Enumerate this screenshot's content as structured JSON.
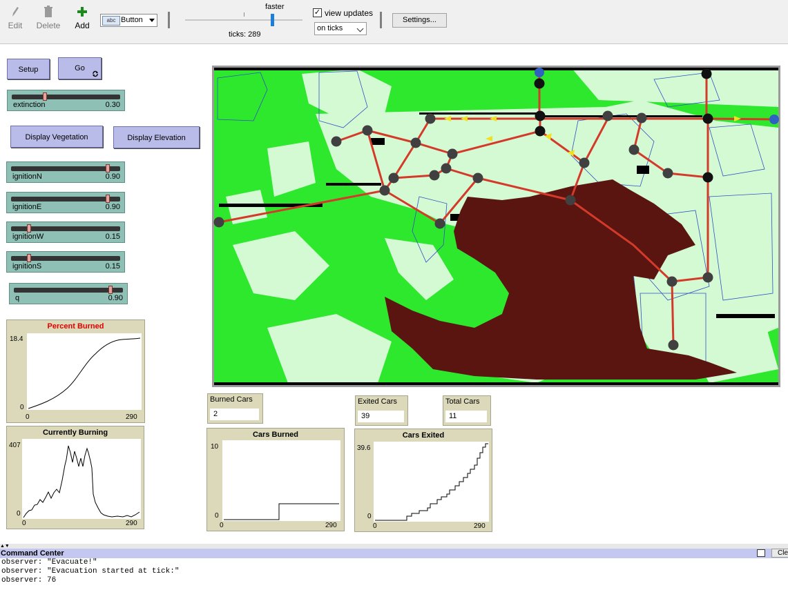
{
  "toolbar": {
    "edit_label": "Edit",
    "delete_label": "Delete",
    "add_label": "Add",
    "widget_type": "Button",
    "widget_icon_text": "abc",
    "speed_label": "faster",
    "ticks_label": "ticks: 289",
    "view_updates_label": "view updates",
    "view_updates_checked": "✓",
    "update_mode": "on ticks",
    "settings_label": "Settings..."
  },
  "buttons": {
    "setup": "Setup",
    "go": "Go",
    "display_vegetation": "Display Vegetation",
    "display_elevation": "Display Elevation"
  },
  "sliders": [
    {
      "name": "extinction",
      "value": "0.30",
      "fraction": 0.3
    },
    {
      "name": "ignitionN",
      "value": "0.90",
      "fraction": 0.9
    },
    {
      "name": "ignitionE",
      "value": "0.90",
      "fraction": 0.9
    },
    {
      "name": "ignitionW",
      "value": "0.15",
      "fraction": 0.15
    },
    {
      "name": "ignitionS",
      "value": "0.15",
      "fraction": 0.15
    },
    {
      "name": "q",
      "value": "0.90",
      "fraction": 0.9
    }
  ],
  "monitors": {
    "burned_cars": {
      "name": "Burned Cars",
      "value": "2"
    },
    "exited_cars": {
      "name": "Exited Cars",
      "value": "39"
    },
    "total_cars": {
      "name": "Total Cars",
      "value": "11"
    }
  },
  "plots": {
    "percent_burned": {
      "title": "Percent Burned",
      "title_color": "#e00000",
      "ymax": "18.4",
      "ymin": "0",
      "xmin": "0",
      "xmax": "290"
    },
    "currently_burning": {
      "title": "Currently Burning",
      "ymax": "407",
      "ymin": "0",
      "xmin": "0",
      "xmax": "290"
    },
    "cars_burned": {
      "title": "Cars Burned",
      "ymax": "10",
      "ymin": "0",
      "xmin": "0",
      "xmax": "290"
    },
    "cars_exited": {
      "title": "Cars Exited",
      "ymax": "39.6",
      "ymin": "0",
      "xmin": "0",
      "xmax": "290"
    }
  },
  "command_center": {
    "title": "Command Center",
    "clear_label": "Cle",
    "output": [
      "observer: \"Evacuate!\"",
      "observer: \"Evacuation started at tick:\"",
      "observer: 76"
    ]
  },
  "colors": {
    "button_bg": "#b9bbe8",
    "slider_bg": "#8ec0b5",
    "plot_bg": "#dbd9b9",
    "fire": "#5a1510",
    "vegetation_bright": "#2ee82e",
    "vegetation_pale": "#d4fad4",
    "road": "#d43a2a",
    "node": "#404040",
    "exit_node": "#3060c0",
    "car": "#f0e020"
  }
}
